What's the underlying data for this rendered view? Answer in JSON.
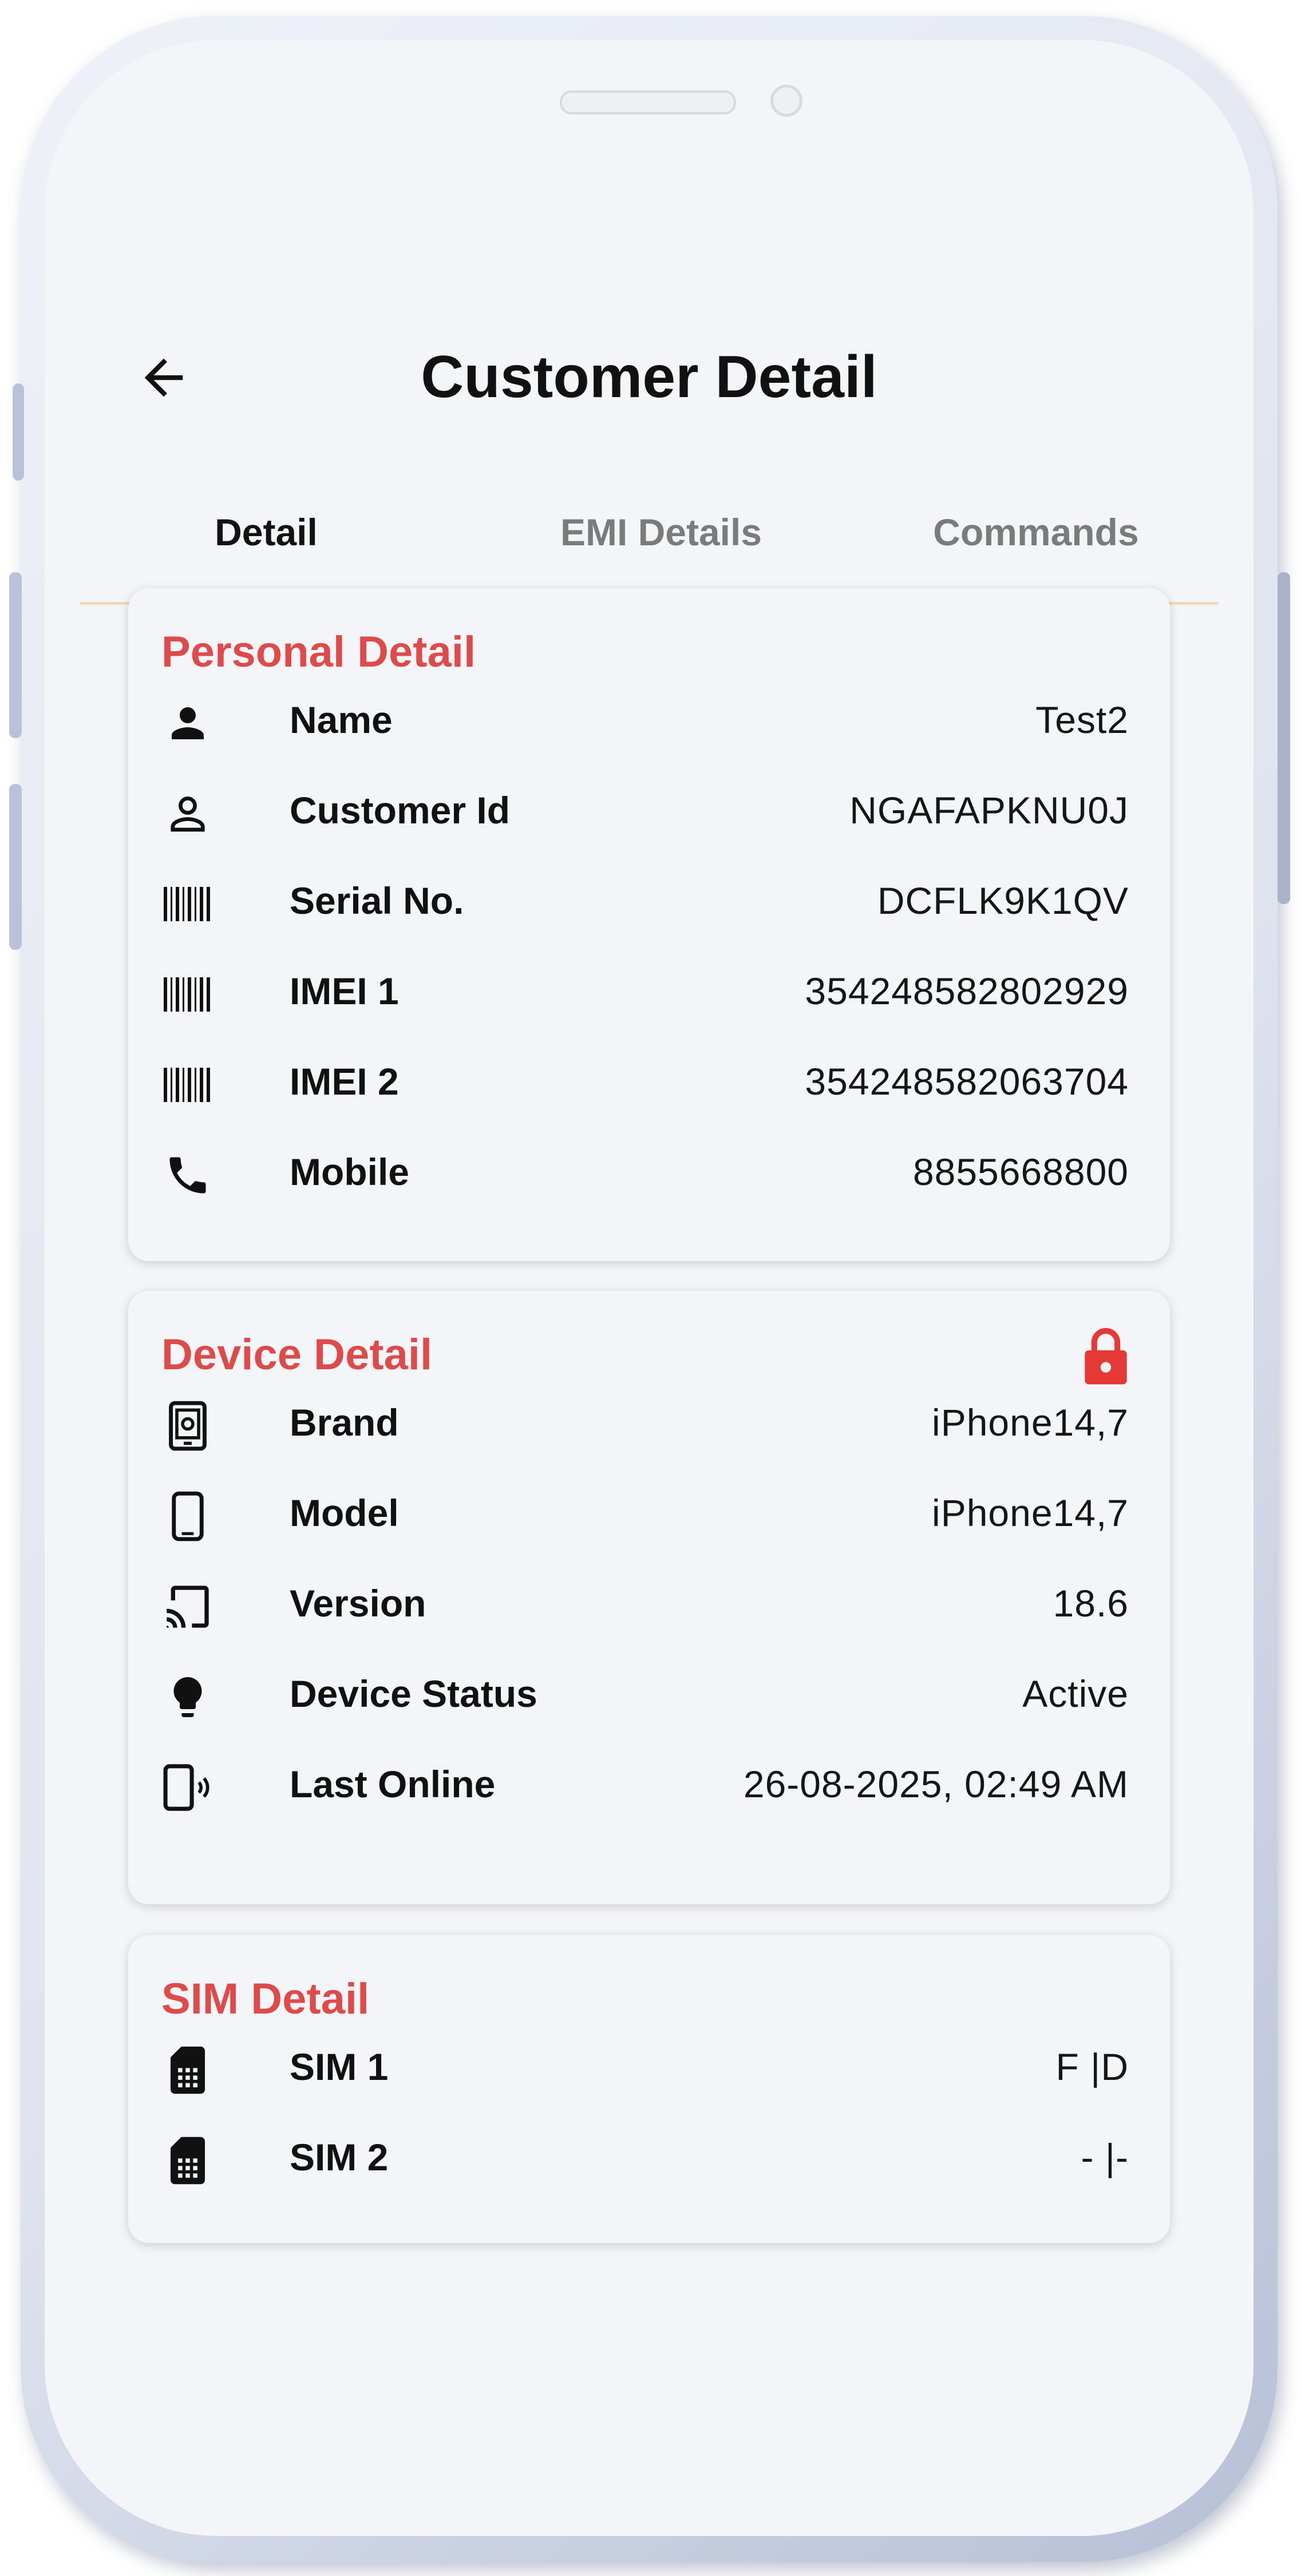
{
  "header": {
    "title": "Customer Detail",
    "back_icon": "arrow-left-icon"
  },
  "tabs": [
    {
      "label": "Detail",
      "active": true
    },
    {
      "label": "EMI Details",
      "active": false
    },
    {
      "label": "Commands",
      "active": false
    }
  ],
  "colors": {
    "accent": "#dd4b4b",
    "background": "#f4f5f8",
    "text": "#111111",
    "inactive_tab": "#7b7b7b"
  },
  "personal": {
    "title": "Personal Detail",
    "rows": [
      {
        "icon": "person-icon",
        "label": "Name",
        "value": "Test2"
      },
      {
        "icon": "person-outline-icon",
        "label": "Customer Id",
        "value": "NGAFAPKNU0J"
      },
      {
        "icon": "barcode-icon",
        "label": "Serial No.",
        "value": "DCFLK9K1QV"
      },
      {
        "icon": "barcode-icon",
        "label": "IMEI 1",
        "value": "354248582802929"
      },
      {
        "icon": "barcode-icon",
        "label": "IMEI 2",
        "value": "354248582063704"
      },
      {
        "icon": "phone-icon",
        "label": "Mobile",
        "value": "8855668800"
      }
    ]
  },
  "device": {
    "title": "Device Detail",
    "status_icon": "lock-icon",
    "rows": [
      {
        "icon": "device-brand-icon",
        "label": "Brand",
        "value": "iPhone14,7"
      },
      {
        "icon": "smartphone-icon",
        "label": "Model",
        "value": "iPhone14,7"
      },
      {
        "icon": "cast-icon",
        "label": "Version",
        "value": "18.6"
      },
      {
        "icon": "lightbulb-icon",
        "label": "Device Status",
        "value": "Active"
      },
      {
        "icon": "device-signal-icon",
        "label": "Last Online",
        "value": "26-08-2025, 02:49 AM"
      }
    ]
  },
  "sim": {
    "title": "SIM Detail",
    "rows": [
      {
        "icon": "sim-card-icon",
        "label": "SIM 1",
        "value": "F |D"
      },
      {
        "icon": "sim-card-icon",
        "label": "SIM 2",
        "value": "- |-"
      }
    ]
  }
}
